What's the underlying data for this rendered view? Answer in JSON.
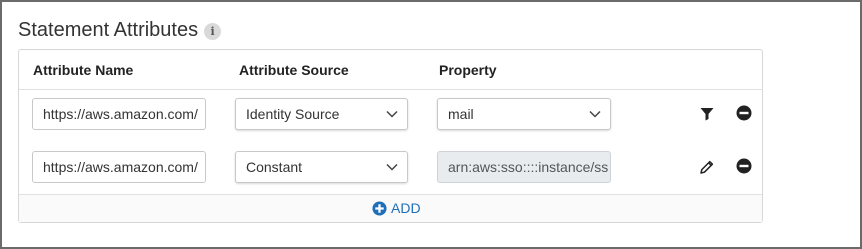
{
  "section": {
    "title": "Statement Attributes",
    "info_icon": "i"
  },
  "table": {
    "headers": [
      "Attribute Name",
      "Attribute Source",
      "Property"
    ],
    "rows": [
      {
        "attribute_name": "https://aws.amazon.com/",
        "attribute_source": "Identity Source",
        "property": "mail",
        "property_type": "select",
        "action_icon": "filter-icon",
        "remove_icon": "minus-circle-icon"
      },
      {
        "attribute_name": "https://aws.amazon.com/",
        "attribute_source": "Constant",
        "property": "arn:aws:sso::::instance/ss",
        "property_type": "text-disabled",
        "action_icon": "pencil-icon",
        "remove_icon": "minus-circle-icon"
      }
    ]
  },
  "add_button": {
    "label": "ADD",
    "icon": "plus-circle-icon"
  },
  "colors": {
    "accent": "#1f6fb8",
    "disabled_bg": "#e9ecef"
  }
}
